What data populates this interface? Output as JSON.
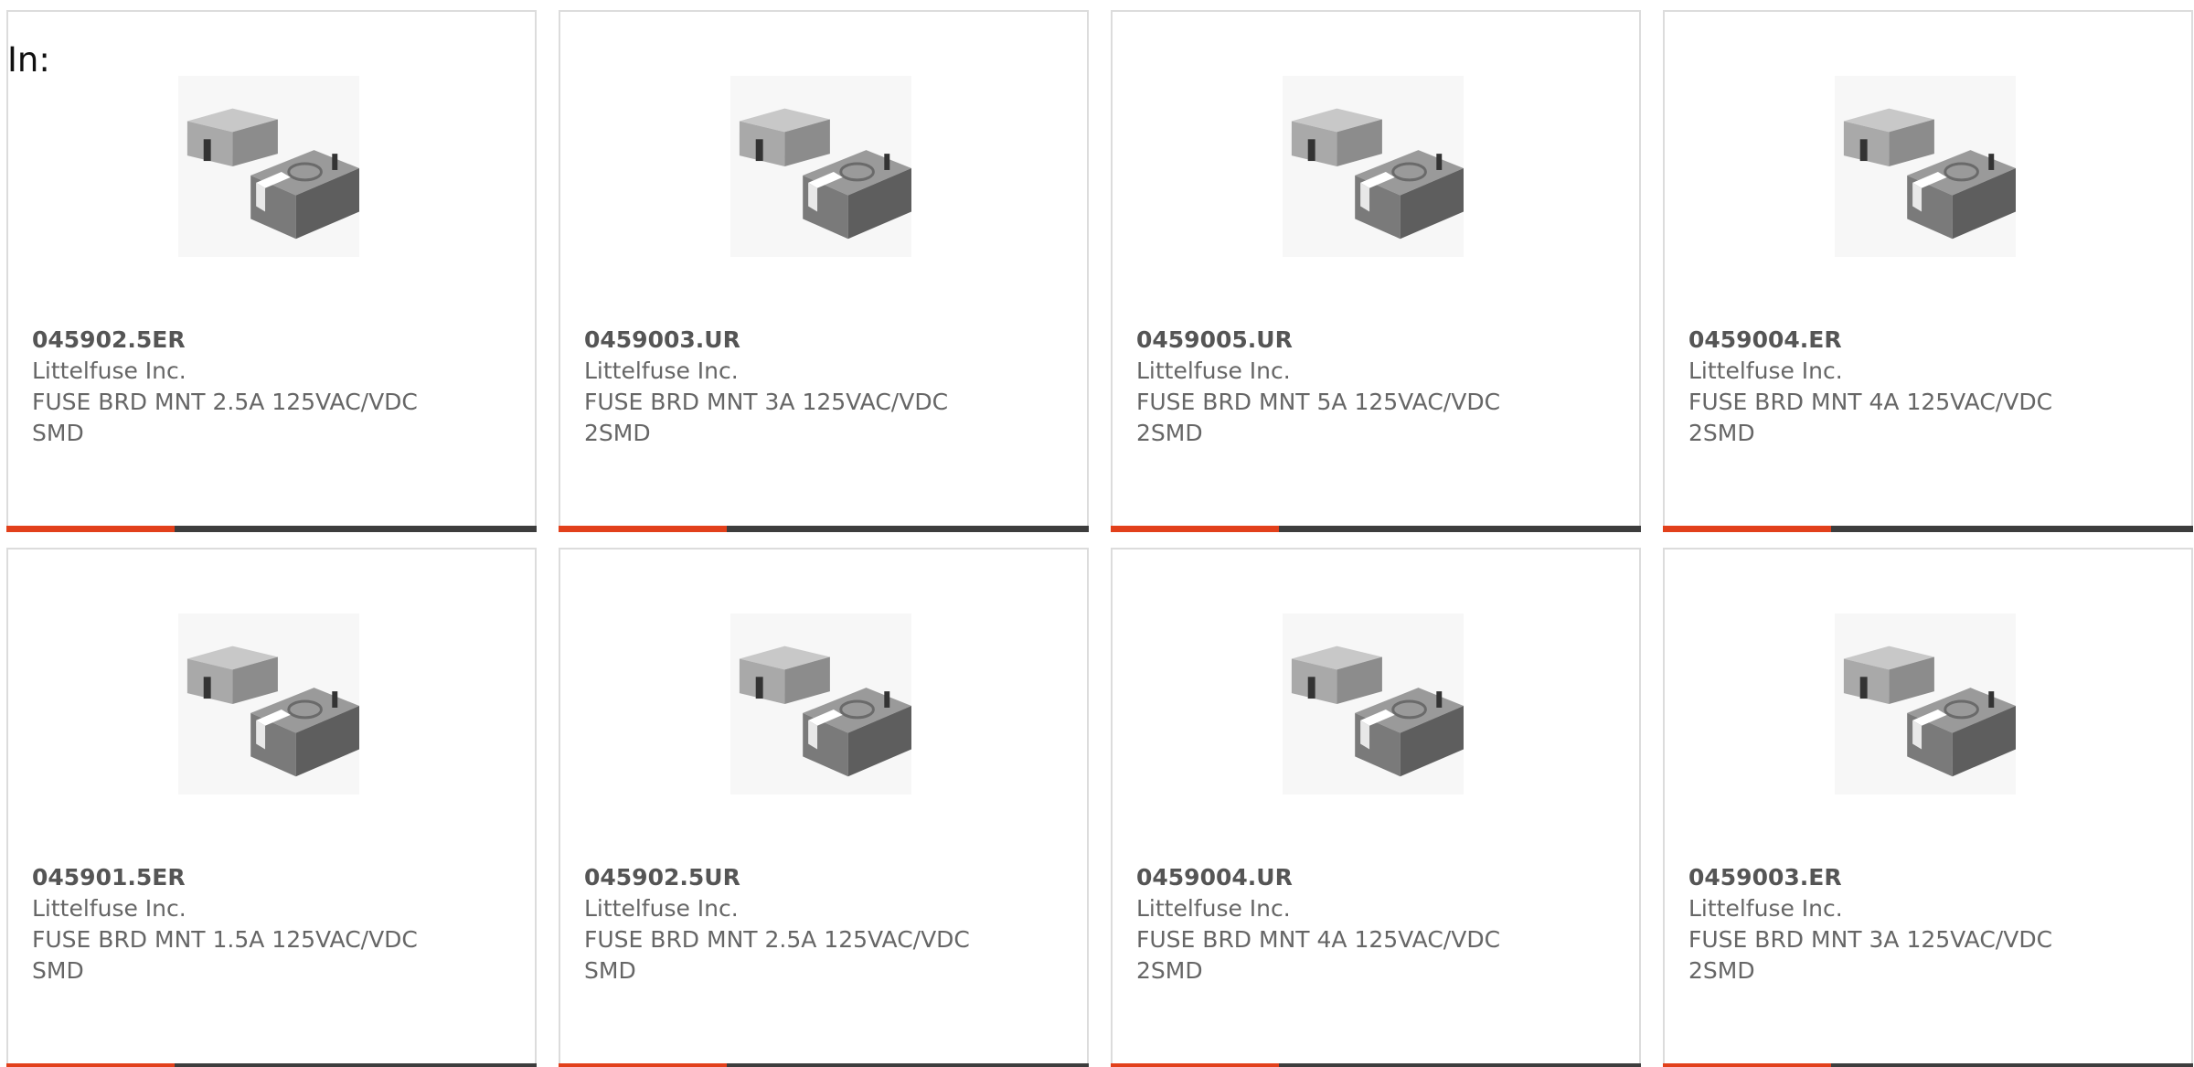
{
  "filter": {
    "label": "In:"
  },
  "colors": {
    "accent": "#e2401b",
    "bar": "#3d3d3d",
    "border": "#dcdcdc",
    "text": "#666666"
  },
  "products": [
    {
      "part": "045902.5ER",
      "manufacturer": "Littelfuse Inc.",
      "description": "FUSE BRD MNT 2.5A 125VAC/VDC SMD",
      "image": "smd-fuse-image"
    },
    {
      "part": "0459003.UR",
      "manufacturer": "Littelfuse Inc.",
      "description": "FUSE BRD MNT 3A 125VAC/VDC 2SMD",
      "image": "smd-fuse-image"
    },
    {
      "part": "0459005.UR",
      "manufacturer": "Littelfuse Inc.",
      "description": "FUSE BRD MNT 5A 125VAC/VDC 2SMD",
      "image": "smd-fuse-image"
    },
    {
      "part": "0459004.ER",
      "manufacturer": "Littelfuse Inc.",
      "description": "FUSE BRD MNT 4A 125VAC/VDC 2SMD",
      "image": "smd-fuse-image"
    },
    {
      "part": "045901.5ER",
      "manufacturer": "Littelfuse Inc.",
      "description": "FUSE BRD MNT 1.5A 125VAC/VDC SMD",
      "image": "smd-fuse-image"
    },
    {
      "part": "045902.5UR",
      "manufacturer": "Littelfuse Inc.",
      "description": "FUSE BRD MNT 2.5A 125VAC/VDC SMD",
      "image": "smd-fuse-image"
    },
    {
      "part": "0459004.UR",
      "manufacturer": "Littelfuse Inc.",
      "description": "FUSE BRD MNT 4A 125VAC/VDC 2SMD",
      "image": "smd-fuse-image"
    },
    {
      "part": "0459003.ER",
      "manufacturer": "Littelfuse Inc.",
      "description": "FUSE BRD MNT 3A 125VAC/VDC 2SMD",
      "image": "smd-fuse-image"
    }
  ]
}
